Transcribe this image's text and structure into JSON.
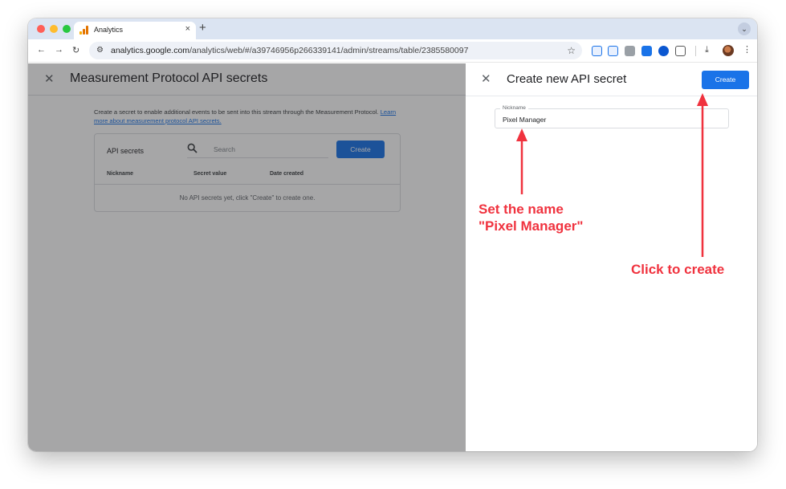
{
  "browser": {
    "tab_title": "Analytics",
    "tab_close": "×",
    "new_tab": "+",
    "url_domain": "analytics.google.com",
    "url_path": "/analytics/web/#/a39746956p266339141/admin/streams/table/2385580097"
  },
  "background_page": {
    "title": "Measurement Protocol API secrets",
    "intro_text": "Create a secret to enable additional events to be sent into this stream through the Measurement Protocol.",
    "intro_link": "Learn more about measurement protocol API secrets.",
    "card_title": "API secrets",
    "search_placeholder": "Search",
    "create_label": "Create",
    "columns": [
      "Nickname",
      "Secret value",
      "Date created"
    ],
    "empty_message": "No API secrets yet, click \"Create\" to create one."
  },
  "panel": {
    "title": "Create new API secret",
    "create_label": "Create",
    "nickname_label": "Nickname",
    "nickname_value": "Pixel Manager"
  },
  "annotations": {
    "set_name_line1": "Set the name",
    "set_name_line2": "\"Pixel Manager\"",
    "click_create": "Click to create",
    "color": "#f0323e"
  },
  "colors": {
    "accent": "#1a73e8",
    "tabstrip": "#dbe4f2",
    "overlay": "rgba(32,33,36,0.40)"
  }
}
